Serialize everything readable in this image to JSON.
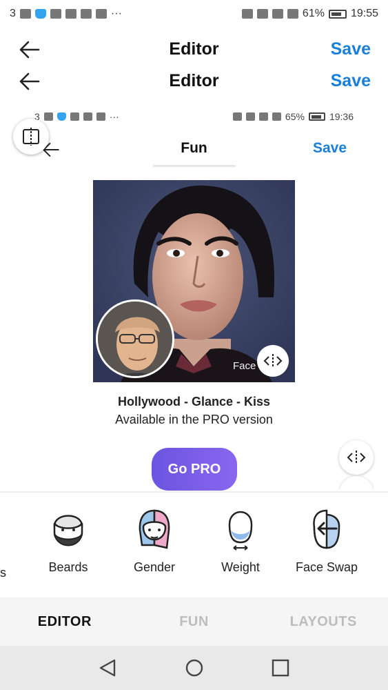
{
  "status_bar": {
    "notif_count": "3",
    "more": "···",
    "battery": "61%",
    "time": "19:55"
  },
  "header_primary": {
    "title": "Editor",
    "save": "Save"
  },
  "header_secondary": {
    "title": "Editor",
    "save": "Save"
  },
  "embedded_status_bar": {
    "notif_count": "3",
    "more": "···",
    "battery": "65%",
    "time": "19:36"
  },
  "header_fun": {
    "title": "Fun",
    "save": "Save"
  },
  "preview": {
    "watermark": "Face"
  },
  "pro_notice": {
    "title": "Hollywood - Glance - Kiss",
    "subtitle": "Available in the PRO version",
    "button": "Go PRO"
  },
  "tools": [
    {
      "label": "s"
    },
    {
      "label": "Beards",
      "icon": "beard-face-icon"
    },
    {
      "label": "Gender",
      "icon": "gender-face-icon"
    },
    {
      "label": "Weight",
      "icon": "weight-face-icon"
    },
    {
      "label": "Face Swap",
      "icon": "face-swap-icon"
    }
  ],
  "tabs": [
    {
      "label": "EDITOR",
      "active": true
    },
    {
      "label": "FUN",
      "active": false
    },
    {
      "label": "LAYOUTS",
      "active": false
    }
  ],
  "colors": {
    "accent": "#1a7fd8",
    "pro_gradient_start": "#6a55e0",
    "pro_gradient_end": "#8a66f0"
  }
}
